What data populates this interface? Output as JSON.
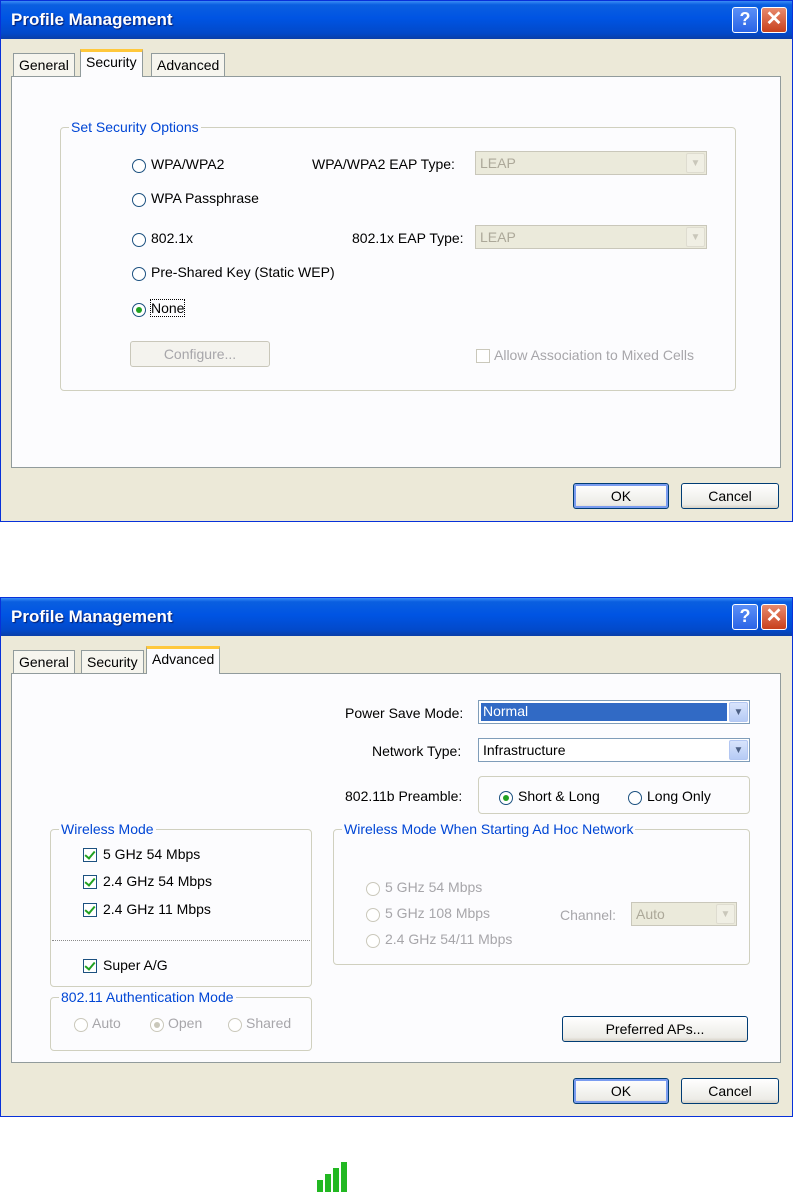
{
  "dialog1": {
    "title": "Profile Management",
    "help_symbol": "?",
    "close_symbol": "✕",
    "tabs": [
      "General",
      "Security",
      "Advanced"
    ],
    "active_tab": "Security",
    "security_group": {
      "legend": "Set Security Options",
      "options": [
        "WPA/WPA2",
        "WPA Passphrase",
        "802.1x",
        "Pre-Shared Key (Static WEP)",
        "None"
      ],
      "selected": "None",
      "wpa_eap_label": "WPA/WPA2 EAP Type:",
      "wpa_eap_value": "LEAP",
      "x1_eap_label": "802.1x EAP Type:",
      "x1_eap_value": "LEAP",
      "configure_button": "Configure...",
      "mixed_cells_label": "Allow Association to Mixed Cells"
    },
    "ok_button": "OK",
    "cancel_button": "Cancel"
  },
  "dialog2": {
    "title": "Profile Management",
    "help_symbol": "?",
    "close_symbol": "✕",
    "tabs": [
      "General",
      "Security",
      "Advanced"
    ],
    "active_tab": "Advanced",
    "power_save_label": "Power Save Mode:",
    "power_save_value": "Normal",
    "network_type_label": "Network Type:",
    "network_type_value": "Infrastructure",
    "preamble_label": "802.11b Preamble:",
    "preamble_options": [
      "Short & Long",
      "Long Only"
    ],
    "preamble_selected": "Short & Long",
    "wireless_mode": {
      "legend": "Wireless Mode",
      "options": [
        "5 GHz 54 Mbps",
        "2.4 GHz 54 Mbps",
        "2.4 GHz 11 Mbps"
      ],
      "super_ag": "Super A/G"
    },
    "adhoc_mode": {
      "legend": "Wireless Mode When Starting Ad Hoc Network",
      "options": [
        "5 GHz 54 Mbps",
        "5 GHz 108 Mbps",
        "2.4 GHz 54/11 Mbps"
      ],
      "channel_label": "Channel:",
      "channel_value": "Auto"
    },
    "auth_mode": {
      "legend": "802.11 Authentication Mode",
      "options": [
        "Auto",
        "Open",
        "Shared"
      ],
      "selected": "Open"
    },
    "preferred_aps_button": "Preferred APs...",
    "ok_button": "OK",
    "cancel_button": "Cancel"
  },
  "signal_icon_color": "#22b822"
}
